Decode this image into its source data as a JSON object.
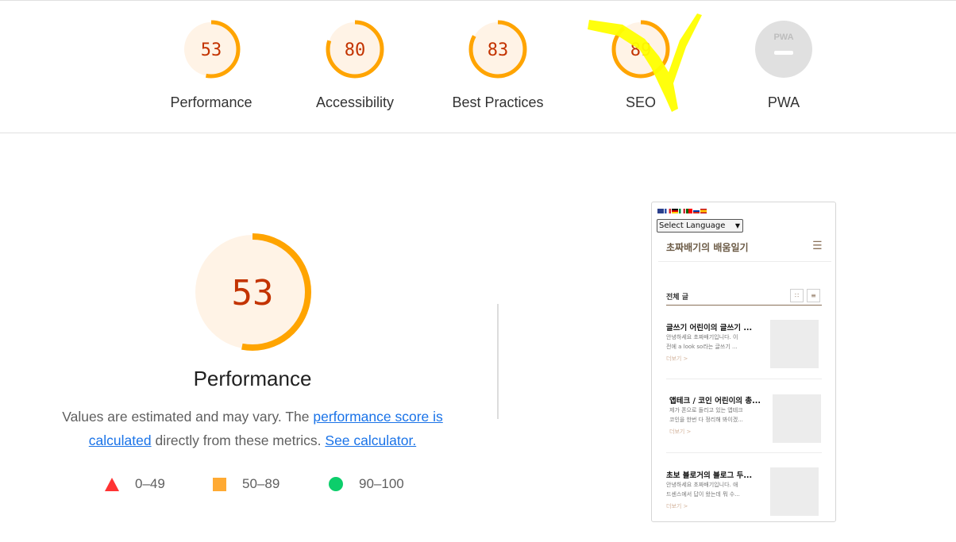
{
  "categories": [
    {
      "id": "performance",
      "label": "Performance",
      "score": 53,
      "fraction": 0.53,
      "color": "#ffa400",
      "bg": "#fff3e6"
    },
    {
      "id": "accessibility",
      "label": "Accessibility",
      "score": 80,
      "fraction": 0.8,
      "color": "#ffa400",
      "bg": "#fff3e6"
    },
    {
      "id": "best-practices",
      "label": "Best Practices",
      "score": 83,
      "fraction": 0.83,
      "color": "#ffa400",
      "bg": "#fff3e6"
    },
    {
      "id": "seo",
      "label": "SEO",
      "score": 89,
      "fraction": 0.89,
      "color": "#ffa400",
      "bg": "#fff3e6"
    },
    {
      "id": "pwa",
      "label": "PWA",
      "badge": "PWA",
      "color": "#cccccc",
      "bg": "#e0e0e0"
    }
  ],
  "main": {
    "score": "53",
    "fraction": 0.53,
    "title": "Performance",
    "desc_prefix": "Values are estimated and may vary. The ",
    "desc_link1": "performance score is calculated",
    "desc_middle": " directly from these metrics. ",
    "desc_link2": "See calculator."
  },
  "legend": [
    {
      "shape": "triangle",
      "label": "0–49",
      "color": "#ff3333"
    },
    {
      "shape": "square",
      "label": "50–89",
      "color": "#ffaa33"
    },
    {
      "shape": "circle",
      "label": "90–100",
      "color": "#0cce6b"
    }
  ],
  "thumbnail": {
    "select_label": "Select Language",
    "blog_title": "초짜배기의 배움일기",
    "section_title": "전체 글",
    "posts": [
      {
        "title": "글쓰기 어린이의 글쓰기 ...",
        "excerpt1": "안녕하세요 초짜배기입니다. 이",
        "excerpt2": "전에 a look so라는 글쓰기 ...",
        "more": "더보기 >"
      },
      {
        "title": "앱테크 / 코인 어린이의 총...",
        "excerpt1": "제가 폰으로 돌리고 있는 앱테크",
        "excerpt2": "코인을 한번 다 정리해 봐이겠...",
        "more": "더보기 >"
      },
      {
        "title": "초보 블로거의 블로그 두...",
        "excerpt1": "안녕하세요 초짜배기입니다. 애",
        "excerpt2": "드센스에서 답이 왔는데 뭐 수...",
        "more": "더보기 >"
      }
    ]
  }
}
